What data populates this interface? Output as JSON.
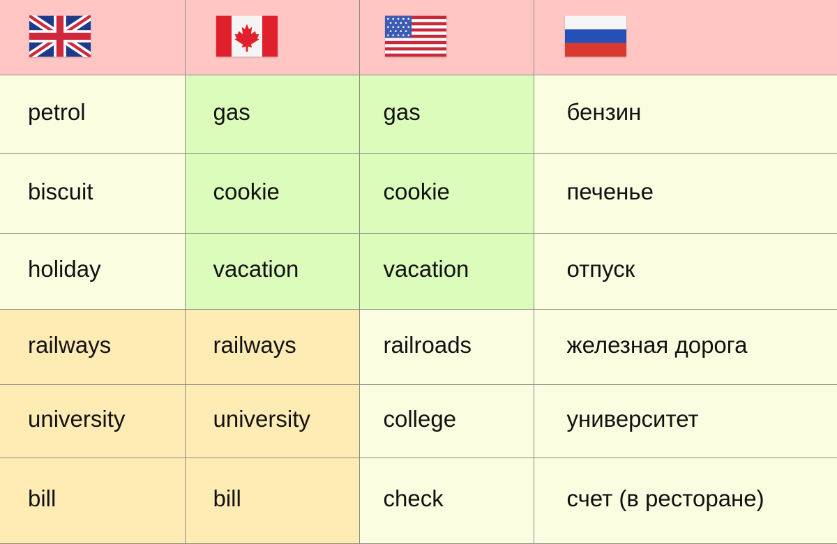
{
  "header": {
    "columns": [
      {
        "flag_icon": "uk-flag-icon",
        "language": "British English"
      },
      {
        "flag_icon": "canada-flag-icon",
        "language": "Canadian English"
      },
      {
        "flag_icon": "usa-flag-icon",
        "language": "American English"
      },
      {
        "flag_icon": "russia-flag-icon",
        "language": "Russian"
      }
    ]
  },
  "colors": {
    "header_bg": "#ffc6c4",
    "default_bg": "#fafde0",
    "green_highlight": "#dcfcbc",
    "orange_highlight": "#feecb4",
    "grid_line": "#8a8a80"
  },
  "rows": [
    {
      "uk": "petrol",
      "ca": "gas",
      "us": "gas",
      "ru": "бензин",
      "highlight": {
        "uk": "cream",
        "ca": "green",
        "us": "green",
        "ru": "cream"
      }
    },
    {
      "uk": "biscuit",
      "ca": "cookie",
      "us": "cookie",
      "ru": "печенье",
      "highlight": {
        "uk": "cream",
        "ca": "green",
        "us": "green",
        "ru": "cream"
      }
    },
    {
      "uk": "holiday",
      "ca": "vacation",
      "us": "vacation",
      "ru": "отпуск",
      "highlight": {
        "uk": "cream",
        "ca": "green",
        "us": "green",
        "ru": "cream"
      }
    },
    {
      "uk": "railways",
      "ca": "railways",
      "us": "railroads",
      "ru": "железная дорога",
      "highlight": {
        "uk": "orange",
        "ca": "orange",
        "us": "cream",
        "ru": "cream"
      }
    },
    {
      "uk": "university",
      "ca": "university",
      "us": "college",
      "ru": "университет",
      "highlight": {
        "uk": "orange",
        "ca": "orange",
        "us": "cream",
        "ru": "cream"
      }
    },
    {
      "uk": "bill",
      "ca": "bill",
      "us": "check",
      "ru": "счет (в ресторане)",
      "highlight": {
        "uk": "orange",
        "ca": "orange",
        "us": "cream",
        "ru": "cream"
      }
    }
  ]
}
